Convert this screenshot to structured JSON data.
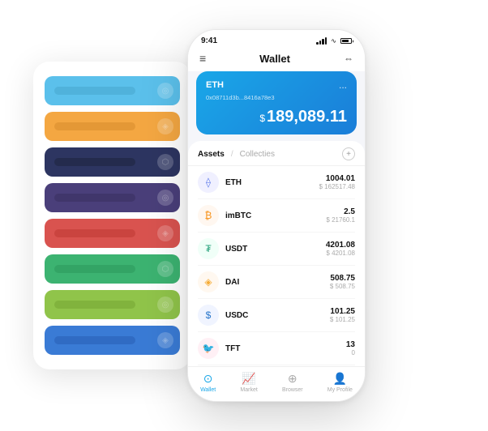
{
  "scene": {
    "bgCards": [
      {
        "color": "#5bc0eb",
        "textColor": "#4aa8d0",
        "icon": "◎"
      },
      {
        "color": "#f4a742",
        "textColor": "#d98e2e",
        "icon": "◈"
      },
      {
        "color": "#2d3561",
        "textColor": "#1e2540",
        "icon": "⬡"
      },
      {
        "color": "#4a3f7a",
        "textColor": "#3a3060",
        "icon": "◎"
      },
      {
        "color": "#d9534f",
        "textColor": "#bf3a36",
        "icon": "◈"
      },
      {
        "color": "#3cb371",
        "textColor": "#2d9a5e",
        "icon": "⬡"
      },
      {
        "color": "#90c44a",
        "textColor": "#78a836",
        "icon": "◎"
      },
      {
        "color": "#3a7bd5",
        "textColor": "#2960b8",
        "icon": "◈"
      }
    ]
  },
  "phone": {
    "statusBar": {
      "time": "9:41",
      "signalBars": [
        3,
        5,
        7,
        9,
        11
      ],
      "battery": 70
    },
    "header": {
      "menu": "≡",
      "title": "Wallet",
      "scan": "⇔"
    },
    "ethCard": {
      "label": "ETH",
      "address": "0x08711d3b...8416a78e3",
      "more": "...",
      "balanceSymbol": "$",
      "balance": "189,089.11"
    },
    "assets": {
      "activeTab": "Assets",
      "separator": "/",
      "inactiveTab": "Collecties",
      "addIcon": "+",
      "items": [
        {
          "name": "ETH",
          "amount": "1004.01",
          "usd": "$ 162517.48",
          "iconBg": "#f0f0ff",
          "iconColor": "#627eea",
          "iconText": "⟠"
        },
        {
          "name": "imBTC",
          "amount": "2.5",
          "usd": "$ 21760.1",
          "iconBg": "#fff7f0",
          "iconColor": "#f7931a",
          "iconText": "₿"
        },
        {
          "name": "USDT",
          "amount": "4201.08",
          "usd": "$ 4201.08",
          "iconBg": "#f0fff8",
          "iconColor": "#26a17b",
          "iconText": "₮"
        },
        {
          "name": "DAI",
          "amount": "508.75",
          "usd": "$ 508.75",
          "iconBg": "#fff8f0",
          "iconColor": "#f5ac37",
          "iconText": "◈"
        },
        {
          "name": "USDC",
          "amount": "101.25",
          "usd": "$ 101.25",
          "iconBg": "#f0f4ff",
          "iconColor": "#2775ca",
          "iconText": "$"
        },
        {
          "name": "TFT",
          "amount": "13",
          "usd": "0",
          "iconBg": "#fff0f5",
          "iconColor": "#e0306a",
          "iconText": "🐦"
        }
      ]
    },
    "nav": [
      {
        "icon": "⊙",
        "label": "Wallet",
        "active": true
      },
      {
        "icon": "📈",
        "label": "Market",
        "active": false
      },
      {
        "icon": "⊕",
        "label": "Browser",
        "active": false
      },
      {
        "icon": "👤",
        "label": "My Profile",
        "active": false
      }
    ]
  }
}
